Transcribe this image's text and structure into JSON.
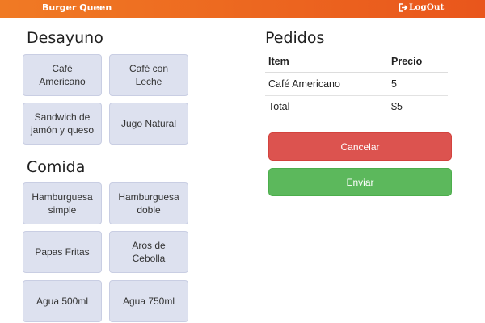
{
  "header": {
    "brand": "Burger Queen",
    "logout_label": "LogOut",
    "logout_icon": "logout-icon",
    "colors": {
      "bar_start": "#f07a24",
      "bar_end": "#e9561c"
    }
  },
  "menu": {
    "breakfast": {
      "title": "Desayuno",
      "items": [
        "Café Americano",
        "Café con Leche",
        "Sandwich de jamón y queso",
        "Jugo Natural"
      ]
    },
    "lunch": {
      "title": "Comida",
      "items": [
        "Hamburguesa simple",
        "Hamburguesa doble",
        "Papas Fritas",
        "Aros de Cebolla",
        "Agua 500ml",
        "Agua 750ml"
      ]
    }
  },
  "orders": {
    "title": "Pedidos",
    "columns": [
      "Item",
      "Precio"
    ],
    "rows": [
      {
        "item": "Café Americano",
        "price": "5"
      }
    ],
    "total_label": "Total",
    "total_value": "$5"
  },
  "actions": {
    "cancel_label": "Cancelar",
    "send_label": "Enviar",
    "colors": {
      "cancel": "#dc534f",
      "send": "#5cb85c"
    }
  }
}
